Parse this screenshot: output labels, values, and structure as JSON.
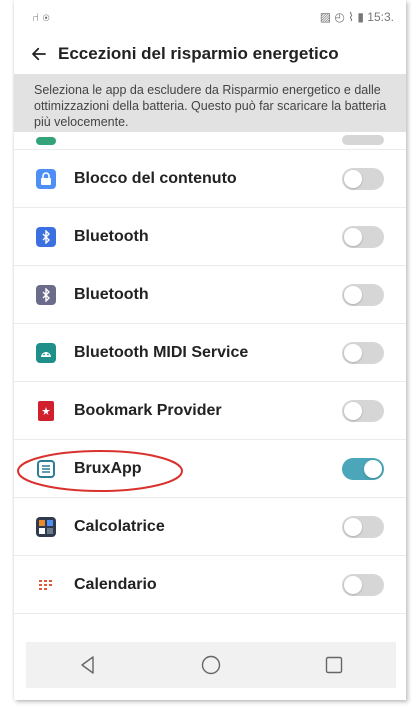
{
  "status_bar": {
    "left": "⑁ ◉",
    "right": "▨ ◴ ⌇ ▮ 15:3."
  },
  "header": {
    "title": "Eccezioni del risparmio energetico"
  },
  "banner": {
    "text": "Seleziona le app da escludere da Risparmio energetico e dalle ottimizzazioni della batteria. Questo può far scaricare la batteria più velocemente."
  },
  "apps": [
    {
      "name": "Blocco del contenuto",
      "enabled": false,
      "icon": "lock-icon",
      "color": "#4e8ef7"
    },
    {
      "name": "Bluetooth",
      "enabled": false,
      "icon": "bluetooth-icon",
      "color": "#3c6fe0"
    },
    {
      "name": "Bluetooth",
      "enabled": false,
      "icon": "bluetooth-icon",
      "color": "#6b6b8a"
    },
    {
      "name": "Bluetooth MIDI Service",
      "enabled": false,
      "icon": "android-icon",
      "color": "#1f8f8a"
    },
    {
      "name": "Bookmark Provider",
      "enabled": false,
      "icon": "bookmark-icon",
      "color": "#d0202e"
    },
    {
      "name": "BruxApp",
      "enabled": true,
      "icon": "bruxapp-icon",
      "color": "#2a7f95"
    },
    {
      "name": "Calcolatrice",
      "enabled": false,
      "icon": "calculator-icon",
      "color": "#2f3b4c"
    },
    {
      "name": "Calendario",
      "enabled": false,
      "icon": "calendar-icon",
      "color": "#e05a3a"
    }
  ],
  "colors": {
    "accent": "#4aa6b8",
    "highlight_circle": "#d9322e"
  },
  "nav": {
    "back": "back-icon",
    "home": "home-icon",
    "recents": "recents-icon"
  }
}
